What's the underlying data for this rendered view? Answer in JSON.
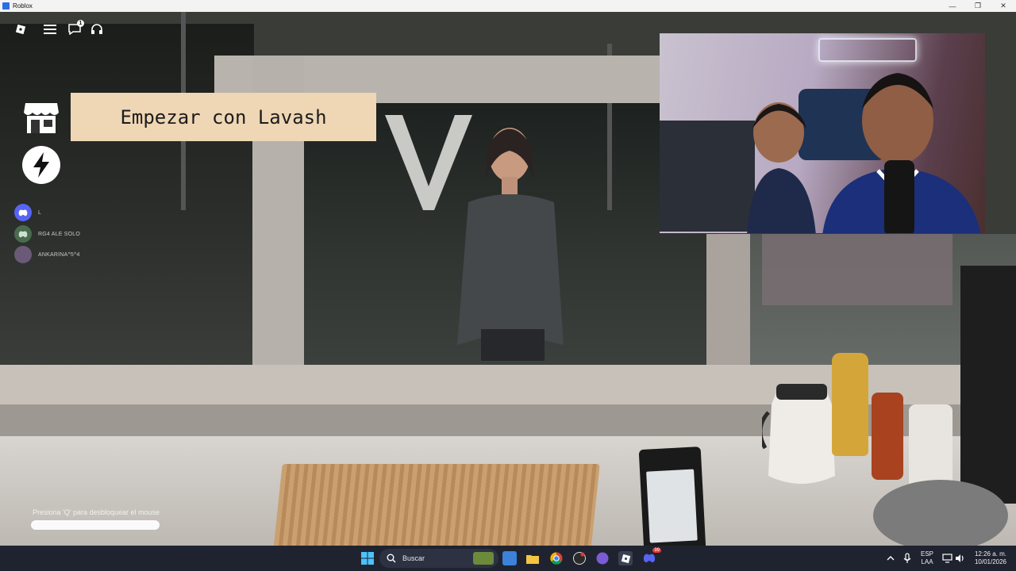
{
  "window": {
    "title": "Roblox"
  },
  "hud": {
    "chat_badge": "1",
    "banner_text": "Empezar con Lavash",
    "players": [
      {
        "name": "L"
      },
      {
        "name": "RG4 ALE SOLO"
      },
      {
        "name": "ANKARINA^5^4"
      }
    ],
    "unlock_hint": "Presiona 'Q' para desbloquear el mouse"
  },
  "taskbar": {
    "search_placeholder": "Buscar",
    "discord_badge": "99",
    "language": "ESP",
    "layout": "LAA",
    "time": "12:26 a. m.",
    "date": "10/01/2026"
  },
  "colors": {
    "banner_bg": "#efd7b5",
    "taskbar_bg": "#1f2330",
    "discord": "#5865f2"
  }
}
